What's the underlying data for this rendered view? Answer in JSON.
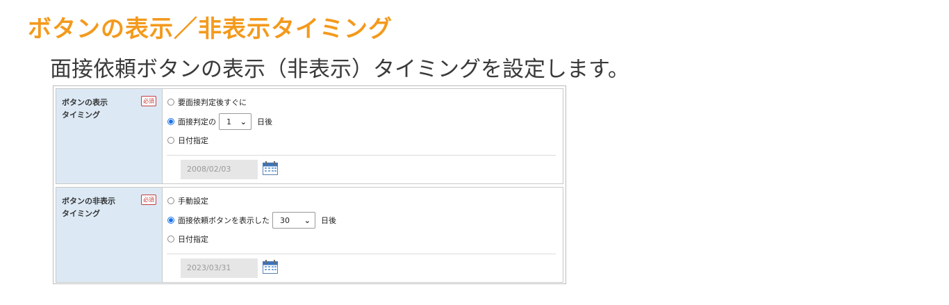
{
  "header": {
    "title": "ボタンの表示／非表示タイミング",
    "subtitle": "面接依頼ボタンの表示（非表示）タイミングを設定します。"
  },
  "colors": {
    "title": "#f39a1d",
    "label_bg": "#dce9f5",
    "required": "#c23b3b",
    "radio_checked": "#1a73e8"
  },
  "show_timing": {
    "label": "ボタンの表示\nタイミング",
    "required_badge": "必須",
    "options": [
      {
        "label": "要面接判定後すぐに",
        "checked": false
      },
      {
        "prefix": "面接判定の",
        "select_value": "1",
        "suffix": "日後",
        "checked": true
      },
      {
        "label": "日付指定",
        "checked": false
      }
    ],
    "date_value": "2008/02/03",
    "calendar_icon": "calendar-icon"
  },
  "hide_timing": {
    "label": "ボタンの非表示\nタイミング",
    "required_badge": "必須",
    "options": [
      {
        "label": "手動設定",
        "checked": false
      },
      {
        "prefix": "面接依頼ボタンを表示した",
        "select_value": "30",
        "suffix": "日後",
        "checked": true
      },
      {
        "label": "日付指定",
        "checked": false
      }
    ],
    "date_value": "2023/03/31",
    "calendar_icon": "calendar-icon"
  }
}
